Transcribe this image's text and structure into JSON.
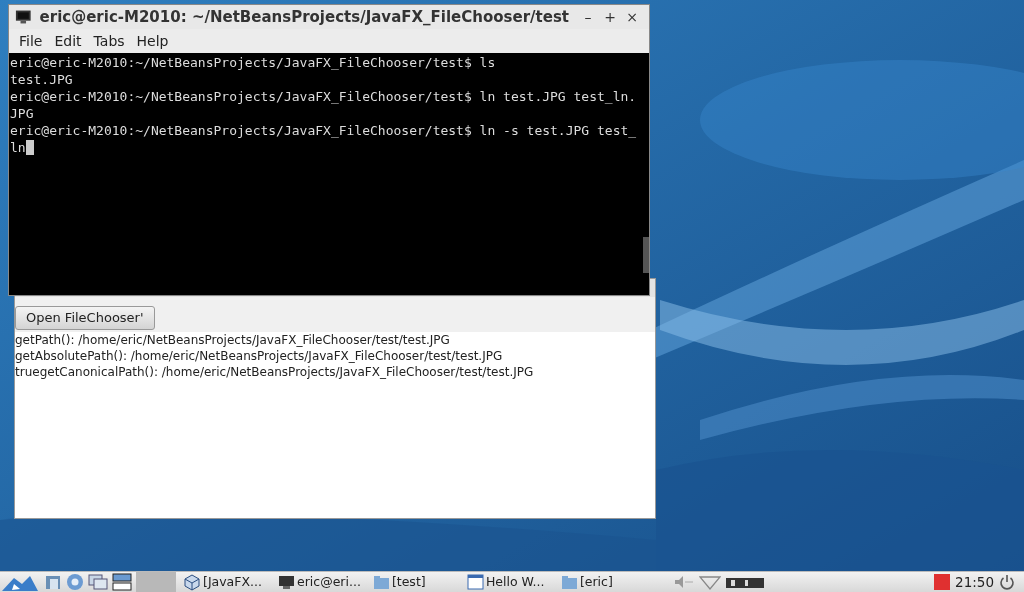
{
  "terminal": {
    "title": "eric@eric-M2010: ~/NetBeansProjects/JavaFX_FileChooser/test",
    "window_buttons": [
      "–",
      "+",
      "×"
    ],
    "menu": [
      "File",
      "Edit",
      "Tabs",
      "Help"
    ],
    "lines": [
      "eric@eric-M2010:~/NetBeansProjects/JavaFX_FileChooser/test$ ls",
      "test.JPG",
      "eric@eric-M2010:~/NetBeansProjects/JavaFX_FileChooser/test$ ln test.JPG test_ln.",
      "JPG",
      "eric@eric-M2010:~/NetBeansProjects/JavaFX_FileChooser/test$ ln -s test.JPG test_",
      "ln"
    ]
  },
  "app": {
    "button": "Open FileChooser'",
    "lines": [
      "getPath(): /home/eric/NetBeansProjects/JavaFX_FileChooser/test/test.JPG",
      "getAbsolutePath(): /home/eric/NetBeansProjects/JavaFX_FileChooser/test/test.JPG",
      "truegetCanonicalPath(): /home/eric/NetBeansProjects/JavaFX_FileChooser/test/test.JPG"
    ]
  },
  "taskbar": {
    "tasks": [
      {
        "label": "[JavaFX...",
        "kind": "cube"
      },
      {
        "label": "eric@eri...",
        "kind": "monitor"
      },
      {
        "label": "[test]",
        "kind": "folder"
      },
      {
        "label": "Hello W...",
        "kind": "window"
      },
      {
        "label": "[eric]",
        "kind": "folder"
      }
    ],
    "clock": "21:50"
  }
}
